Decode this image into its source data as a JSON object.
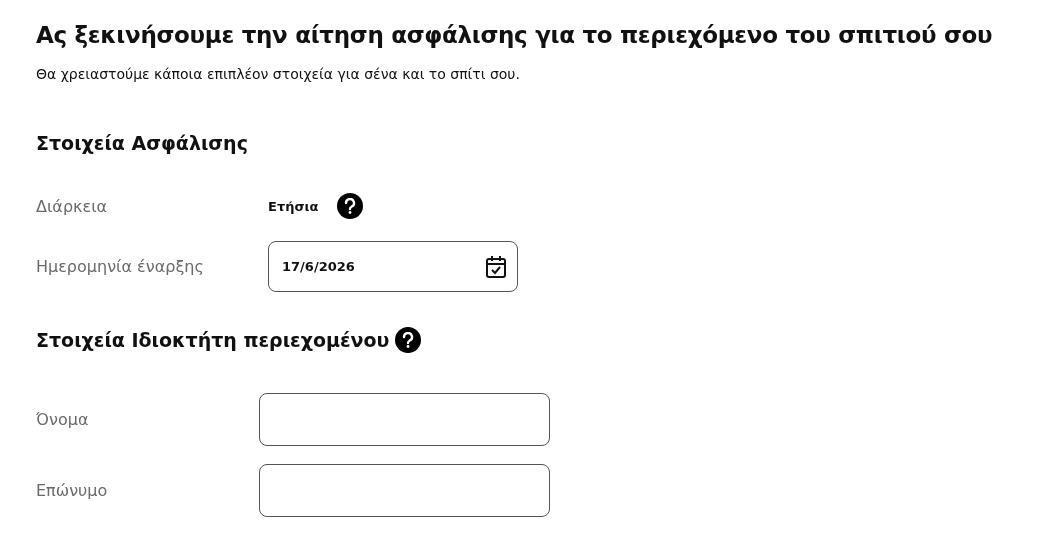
{
  "title": "Ας ξεκινήσουμε την αίτηση ασφάλισης για το περιεχόμενο του σπιτιού σου",
  "subtitle": "Θα χρειαστούμε κάποια επιπλέον στοιχεία για σένα και το σπίτι σου.",
  "sections": [
    {
      "heading": "Στοιχεία Ασφάλισης",
      "help": false,
      "fields": [
        {
          "kind": "text",
          "label": "Διάρκεια",
          "value": "Ετήσια",
          "help": true
        },
        {
          "kind": "date",
          "label": "Ημερομηνία έναρξης",
          "value": "17/6/2026",
          "help": false
        }
      ]
    },
    {
      "heading": "Στοιχεία Ιδιοκτήτη περιεχομένου",
      "help": true,
      "fields": [
        {
          "kind": "input",
          "label": "Όνομα",
          "help": false
        },
        {
          "kind": "input",
          "label": "Επώνυμο",
          "help": false
        }
      ]
    }
  ]
}
